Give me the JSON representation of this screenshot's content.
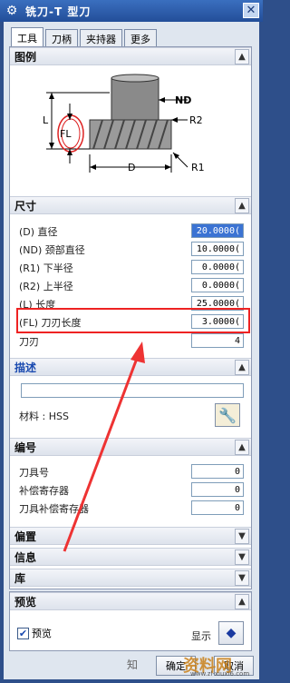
{
  "window": {
    "title": "铣刀-T 型刀"
  },
  "tabs": [
    "工具",
    "刀柄",
    "夹持器",
    "更多"
  ],
  "sections": {
    "legend": "图例",
    "dims": "尺寸",
    "desc": "描述",
    "numbering": "编号",
    "offset": "偏置",
    "info": "信息",
    "library": "库",
    "preview": "预览"
  },
  "diagram_labels": {
    "nd": "ND",
    "r2": "R2",
    "l": "L",
    "fl": "FL",
    "d": "D",
    "r1": "R1"
  },
  "dims": [
    {
      "label": "(D) 直径",
      "value": "20.0000(",
      "selected": true
    },
    {
      "label": "(ND) 颈部直径",
      "value": "10.0000(",
      "selected": false
    },
    {
      "label": "(R1) 下半径",
      "value": "0.0000(",
      "selected": false
    },
    {
      "label": "(R2) 上半径",
      "value": "0.0000(",
      "selected": false
    },
    {
      "label": "(L) 长度",
      "value": "25.0000(",
      "selected": false
    },
    {
      "label": "(FL) 刀刃长度",
      "value": "3.0000(",
      "selected": false
    },
    {
      "label": "刀刃",
      "value": "4",
      "selected": false
    }
  ],
  "description": {
    "text": "",
    "material": "材料 : HSS"
  },
  "numbering": [
    {
      "label": "刀具号",
      "value": "0"
    },
    {
      "label": "补偿寄存器",
      "value": "0"
    },
    {
      "label": "刀具补偿寄存器",
      "value": "0"
    }
  ],
  "preview": {
    "checkbox_label": "预览",
    "show_label": "显示"
  },
  "buttons": {
    "ok": "确定",
    "cancel": "取消"
  },
  "watermark": {
    "left": "知",
    "right": "资料网",
    "url": "www.zl-xiuxi6.com"
  }
}
